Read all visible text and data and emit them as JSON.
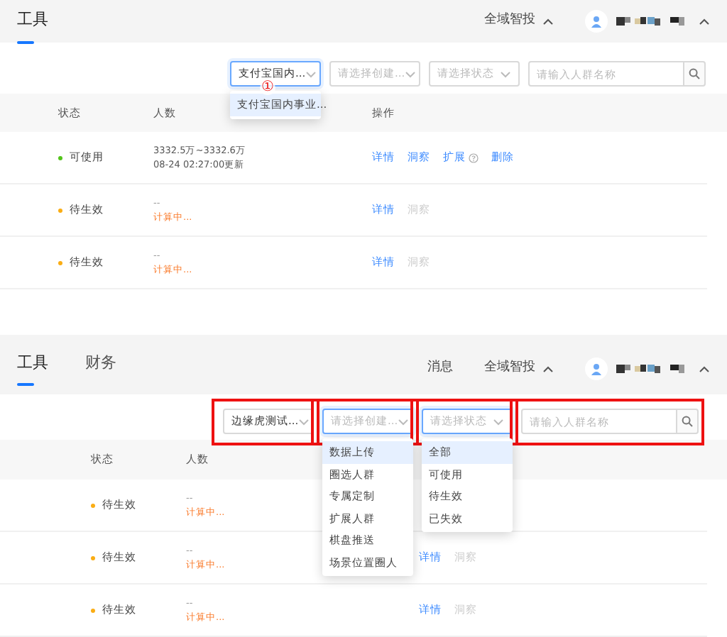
{
  "panels": [
    {
      "tabs": [
        {
          "label": "工具",
          "selected": true
        }
      ],
      "header_items": [
        {
          "kind": "menu",
          "label": "全域智投"
        }
      ],
      "filters": [
        {
          "kind": "select",
          "value": "支付宝国内...",
          "focused": true,
          "highlighted": false,
          "dropdown": {
            "marker": "①",
            "options": [
              {
                "label": "支付宝国内事业...",
                "selected": true
              }
            ]
          }
        },
        {
          "kind": "select",
          "placeholder": "请选择创建...",
          "focused": false,
          "highlighted": false
        },
        {
          "kind": "select",
          "placeholder": "请选择状态",
          "focused": false,
          "highlighted": false
        },
        {
          "kind": "search",
          "placeholder": "请输入人群名称",
          "focused": false,
          "highlighted": false
        }
      ],
      "table": {
        "columns": [
          "状态",
          "人数",
          "操作"
        ],
        "rows": [
          {
            "status": "可使用",
            "color": "#52c41a",
            "count": [
              {
                "text": "3332.5万~3332.6万",
                "kind": "value"
              },
              {
                "text": "08-24 02:27:00更新",
                "kind": "value"
              }
            ],
            "actions": [
              {
                "label": "详情",
                "disabled": false,
                "help": false
              },
              {
                "label": "洞察",
                "disabled": false,
                "help": false
              },
              {
                "label": "扩展",
                "disabled": false,
                "help": true
              },
              {
                "label": "删除",
                "disabled": false,
                "help": false
              }
            ]
          },
          {
            "status": "待生效",
            "color": "#faad14",
            "count": [
              {
                "text": "--",
                "kind": "empty"
              },
              {
                "text": "计算中...",
                "kind": "calculating"
              }
            ],
            "actions": [
              {
                "label": "详情",
                "disabled": false,
                "help": false
              },
              {
                "label": "洞察",
                "disabled": true,
                "help": false
              }
            ]
          },
          {
            "status": "待生效",
            "color": "#faad14",
            "count": [
              {
                "text": "--",
                "kind": "empty"
              },
              {
                "text": "计算中...",
                "kind": "calculating"
              }
            ],
            "actions": [
              {
                "label": "详情",
                "disabled": false,
                "help": false
              },
              {
                "label": "洞察",
                "disabled": true,
                "help": false
              }
            ]
          }
        ]
      }
    },
    {
      "tabs": [
        {
          "label": "工具",
          "selected": true
        },
        {
          "label": "财务",
          "selected": false
        }
      ],
      "header_items": [
        {
          "kind": "link",
          "label": "消息"
        },
        {
          "kind": "menu",
          "label": "全域智投"
        }
      ],
      "filters": [
        {
          "kind": "select",
          "value": "边缘虎测试...",
          "focused": false,
          "highlighted": true
        },
        {
          "kind": "select",
          "placeholder": "请选择创建...",
          "focused": true,
          "highlighted": true,
          "dropdown": {
            "options": [
              {
                "label": "数据上传",
                "selected": true
              },
              {
                "label": "圈选人群",
                "selected": false
              },
              {
                "label": "专属定制",
                "selected": false
              },
              {
                "label": "扩展人群",
                "selected": false
              },
              {
                "label": "棋盘推送",
                "selected": false
              },
              {
                "label": "场景位置圈人",
                "selected": false
              }
            ]
          }
        },
        {
          "kind": "select",
          "placeholder": "请选择状态",
          "focused": true,
          "highlighted": true,
          "dropdown": {
            "options": [
              {
                "label": "全部",
                "selected": true
              },
              {
                "label": "可使用",
                "selected": false
              },
              {
                "label": "待生效",
                "selected": false
              },
              {
                "label": "已失效",
                "selected": false
              }
            ]
          }
        },
        {
          "kind": "search",
          "placeholder": "请输入人群名称",
          "focused": false,
          "highlighted": true
        }
      ],
      "table": {
        "columns": [
          "状态",
          "人数"
        ],
        "rows": [
          {
            "status": "待生效",
            "color": "#faad14",
            "count": [
              {
                "text": "--",
                "kind": "empty"
              },
              {
                "text": "计算中...",
                "kind": "calculating"
              }
            ],
            "actions": []
          },
          {
            "status": "待生效",
            "color": "#faad14",
            "count": [
              {
                "text": "--",
                "kind": "empty"
              },
              {
                "text": "计算中...",
                "kind": "calculating"
              }
            ],
            "actions": [
              {
                "label": "详情",
                "disabled": false,
                "help": false
              },
              {
                "label": "洞察",
                "disabled": true,
                "help": false
              }
            ]
          },
          {
            "status": "待生效",
            "color": "#faad14",
            "count": [
              {
                "text": "--",
                "kind": "empty"
              },
              {
                "text": "计算中...",
                "kind": "calculating"
              }
            ],
            "actions": [
              {
                "label": "详情",
                "disabled": false,
                "help": false
              },
              {
                "label": "洞察",
                "disabled": true,
                "help": false
              }
            ]
          }
        ]
      }
    }
  ]
}
